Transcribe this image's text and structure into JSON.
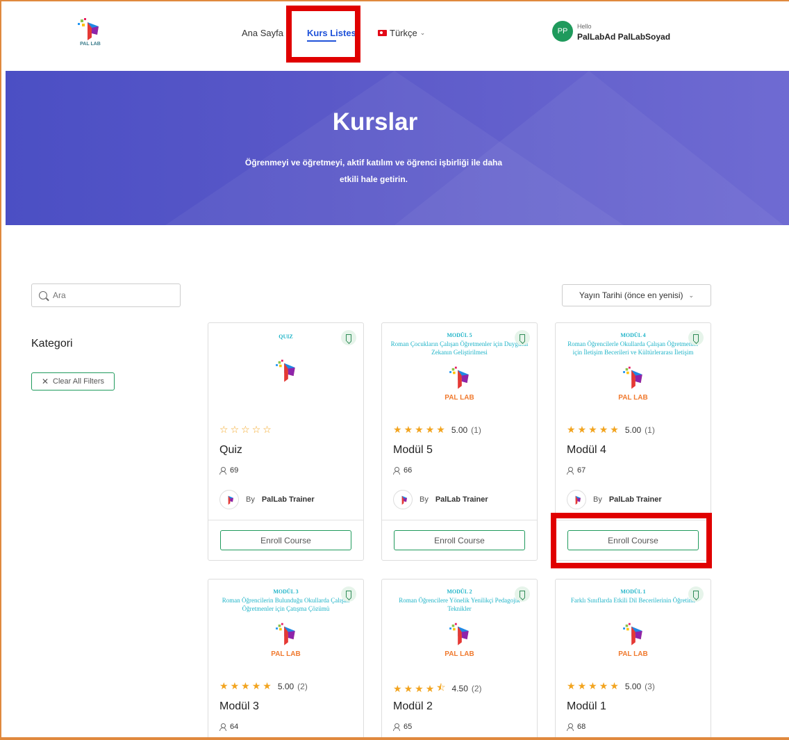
{
  "header": {
    "logo_text": "PAL LAB",
    "nav": [
      {
        "label": "Ana Sayfa"
      },
      {
        "label": "Kurs Listesi"
      },
      {
        "label": "Türkçe"
      }
    ],
    "user": {
      "initials": "PP",
      "greeting": "Hello",
      "name": "PalLabAd PalLabSoyad"
    }
  },
  "hero": {
    "title": "Kurslar",
    "subtitle": "Öğrenmeyi ve öğretmeyi, aktif katılım ve öğrenci işbirliği ile daha etkili hale getirin."
  },
  "sidebar": {
    "search_placeholder": "Ara",
    "category_heading": "Kategori",
    "clear_filters": "Clear All Filters"
  },
  "sort": {
    "selected": "Yayın Tarihi (önce en yenisi)"
  },
  "courses": [
    {
      "cover_head": "QUIZ",
      "cover_sub": "",
      "cover_brand": "",
      "rating": "",
      "rating_count": "",
      "stars": 0,
      "title": "Quiz",
      "students": "69",
      "trainer_by": "By",
      "trainer": "PalLab Trainer",
      "enroll": "Enroll Course"
    },
    {
      "cover_head": "MODÜL 5",
      "cover_sub": "Roman Çocukların Çalışan Öğretmenler için Duygusal Zekanın Geliştirilmesi",
      "cover_brand": "PAL LAB",
      "rating": "5.00",
      "rating_count": "(1)",
      "stars": 5,
      "title": "Modül 5",
      "students": "66",
      "trainer_by": "By",
      "trainer": "PalLab Trainer",
      "enroll": "Enroll Course"
    },
    {
      "cover_head": "MODÜL 4",
      "cover_sub": "Roman Öğrencilerle Okullarda Çalışan Öğretmenler için İletişim Becerileri ve Kültürlerarası İletişim",
      "cover_brand": "PAL LAB",
      "rating": "5.00",
      "rating_count": "(1)",
      "stars": 5,
      "title": "Modül 4",
      "students": "67",
      "trainer_by": "By",
      "trainer": "PalLab Trainer",
      "enroll": "Enroll Course"
    },
    {
      "cover_head": "MODÜL 3",
      "cover_sub": "Roman Öğrencilerin Bulunduğu Okullarda Çalışan Öğretmenler için Çatışma Çözümü",
      "cover_brand": "PAL LAB",
      "rating": "5.00",
      "rating_count": "(2)",
      "stars": 5,
      "title": "Modül 3",
      "students": "64"
    },
    {
      "cover_head": "MODÜL 2",
      "cover_sub": "Roman Öğrencilere Yönelik Yenilikçi Pedagojik Teknikler",
      "cover_brand": "PAL LAB",
      "rating": "4.50",
      "rating_count": "(2)",
      "stars": 4.5,
      "title": "Modül 2",
      "students": "65"
    },
    {
      "cover_head": "MODÜL 1",
      "cover_sub": "Farklı Sınıflarda Etkili Dil Becerilerinin Öğretimi",
      "cover_brand": "PAL LAB",
      "rating": "5.00",
      "rating_count": "(3)",
      "stars": 5,
      "title": "Modül 1",
      "students": "68"
    }
  ],
  "colors": {
    "accent_blue": "#1f52d9",
    "accent_green": "#1f9a5c",
    "highlight_red": "#e00000",
    "star": "#f2a41f",
    "brand_orange": "#f07a2f",
    "cover_teal": "#20b4c8"
  }
}
